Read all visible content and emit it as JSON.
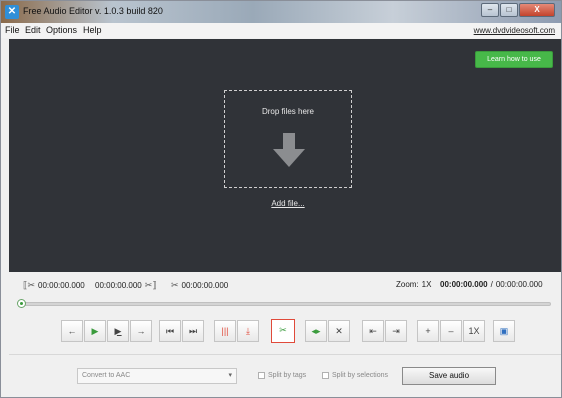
{
  "window": {
    "title": "Free Audio Editor v. 1.0.3 build 820",
    "controls": {
      "minimize": "–",
      "maximize": "□",
      "close": "X"
    }
  },
  "menu": {
    "items": [
      "File",
      "Edit",
      "Options",
      "Help"
    ],
    "site_link": "www.dvdvideosoft.com"
  },
  "dropzone": {
    "learn_button": "Learn how to use",
    "drop_text": "Drop files here",
    "add_file": "Add file..."
  },
  "timeline": {
    "selection_start": "00:00:00.000",
    "selection_end": "00:00:00.000",
    "selection_length": "00:00:00.000",
    "zoom_label": "Zoom:",
    "zoom_value": "1X",
    "current_time": "00:00:00.000",
    "separator": "/",
    "total_time": "00:00:00.000"
  },
  "toolbar": {
    "zoom_reset_label": "1X"
  },
  "bottom": {
    "format_selected": "Convert to AAC",
    "split_tags_label": "Split by tags",
    "split_selections_label": "Split by selections",
    "save_label": "Save audio"
  },
  "colors": {
    "accent_green": "#47b849",
    "dropzone_bg": "#303338",
    "accent_red": "#e04a3a"
  }
}
